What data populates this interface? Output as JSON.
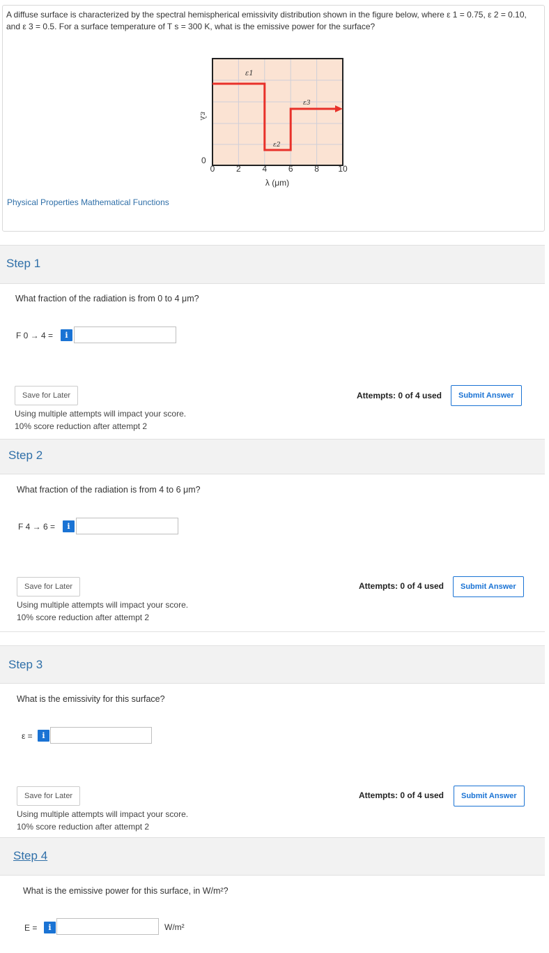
{
  "problem": {
    "text": "A diffuse surface is characterized by the spectral hemispherical emissivity distribution shown in the figure below, where ε 1 = 0.75, ε 2 = 0.10, and ε 3 = 0.5. For a surface temperature of T s = 300 K, what is the emissive power for the surface?",
    "links": [
      "Physical Properties",
      "Mathematical Functions"
    ]
  },
  "figure": {
    "y_axis_label": "ελ",
    "x_axis_label": "λ (μm)",
    "y_zero_label": "0",
    "x_ticks": [
      "0",
      "2",
      "4",
      "6",
      "8",
      "10"
    ],
    "segment_labels": [
      "ε1",
      "ε2",
      "ε3"
    ],
    "colors": {
      "plot_bg": "#fbe3d3",
      "grid": "#cfcfd8",
      "line": "#e8312a",
      "frame": "#222222"
    }
  },
  "common": {
    "save_label": "Save for Later",
    "attempts": "Attempts: 0 of 4 used",
    "submit_label": "Submit Answer",
    "warning_line1": "Using multiple attempts will impact your score.",
    "warning_line2": "10% score reduction after attempt 2",
    "info_icon_glyph": "i"
  },
  "steps": [
    {
      "title": "Step 1",
      "question": "What fraction of the radiation is from 0 to 4 μm?",
      "label": "F 0 → 4 =",
      "value": ""
    },
    {
      "title": "Step 2",
      "question": "What fraction of the radiation is from 4 to 6 μm?",
      "label": "F 4 → 6 =",
      "value": ""
    },
    {
      "title": "Step 3",
      "question": "What is the emissivity for this surface?",
      "label": "ε =",
      "value": ""
    },
    {
      "title": "Step 4",
      "question": "What is the emissive power for this surface, in W/m²?",
      "label": "E =",
      "value": "",
      "unit": "W/m²"
    }
  ]
}
